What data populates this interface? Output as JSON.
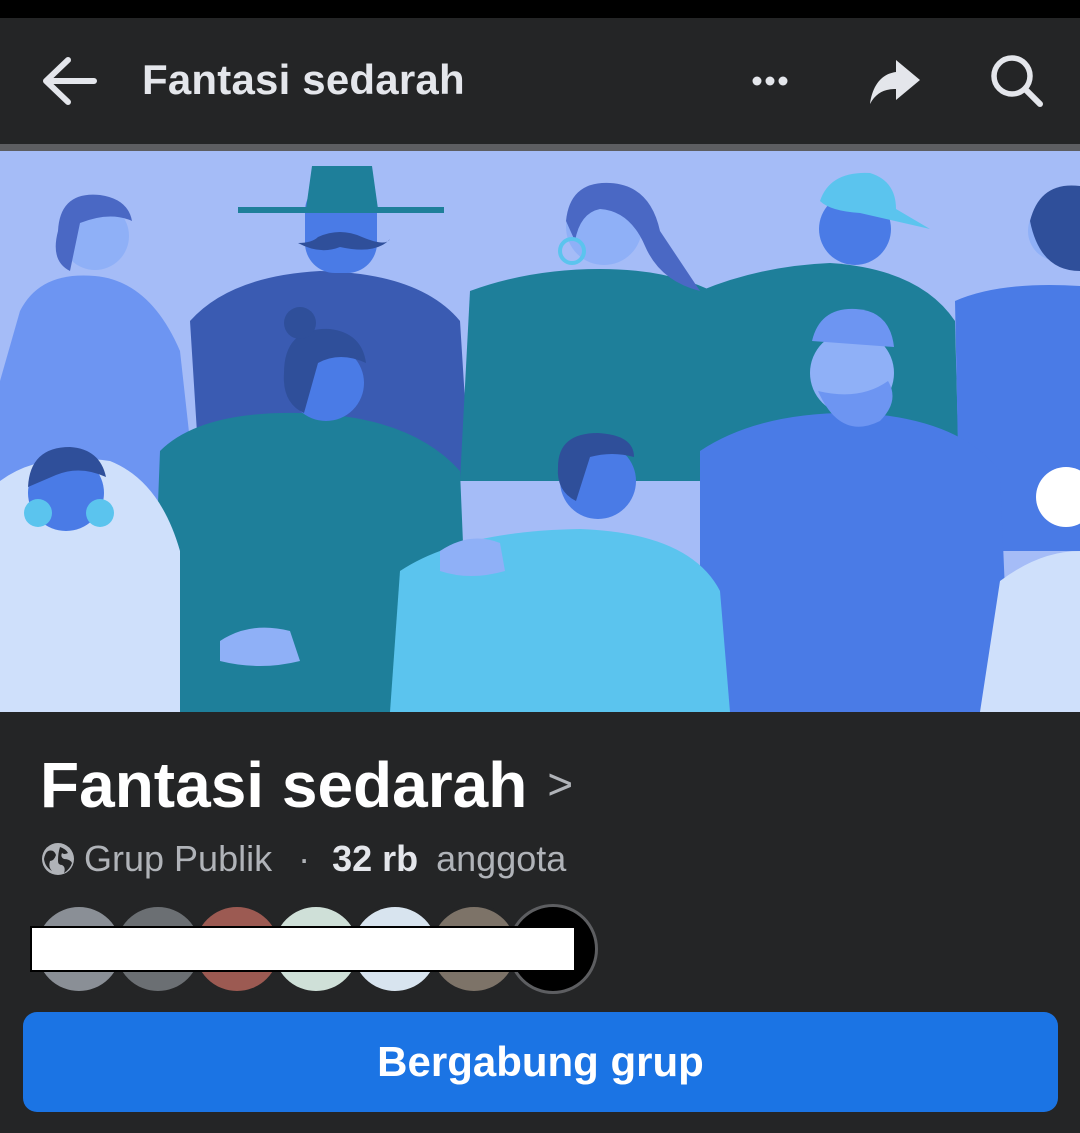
{
  "header": {
    "title": "Fantasi sedarah",
    "icons": [
      "arrow-left-icon",
      "more-horizontal-icon",
      "share-arrow-icon",
      "search-icon"
    ]
  },
  "cover": {
    "icon": "people-crowd-illustration",
    "colors": {
      "background": "#a5bcf7",
      "teal": "#1e7f9a",
      "blue": "#4a7be6",
      "navy": "#2f4f9a",
      "light": "#5bc4ee"
    }
  },
  "group": {
    "name": "Fantasi sedarah",
    "chevron": ">",
    "privacy": "Grup Publik",
    "separator": "·",
    "member_count": "32 rb",
    "member_label": "anggota"
  },
  "members": {
    "avatar_colors": [
      "#8a8f96",
      "#6b6f73",
      "#9c5a52",
      "#cfe0d8",
      "#d8e4ef",
      "#7d7368",
      "#000000"
    ]
  },
  "actions": {
    "join_label": "Bergabung grup"
  },
  "colors": {
    "background": "#242526",
    "accent": "#1b74e4",
    "text_primary": "#e4e6eb",
    "text_secondary": "#b0b3b8"
  }
}
